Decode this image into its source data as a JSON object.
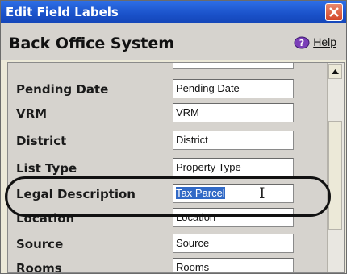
{
  "window": {
    "title": "Edit Field Labels"
  },
  "header": {
    "app_title": "Back Office System",
    "help_label": "Help"
  },
  "rows": [
    {
      "label": "Pending Date",
      "value": "Pending Date",
      "selected": false
    },
    {
      "label": "VRM",
      "value": "VRM",
      "selected": false
    },
    {
      "label": "District",
      "value": "District",
      "selected": false
    },
    {
      "label": "List Type",
      "value": "Property Type",
      "selected": false
    },
    {
      "label": "Legal Description",
      "value": "Tax Parcel",
      "selected": true
    },
    {
      "label": "Location",
      "value": "Location",
      "selected": false
    },
    {
      "label": "Source",
      "value": "Source",
      "selected": false
    },
    {
      "label": "Rooms",
      "value": "Rooms",
      "selected": false
    }
  ],
  "colors": {
    "titlebar": "#1a51c9",
    "selection": "#3169c6",
    "panel": "#d6d3ce"
  },
  "icons": {
    "close": "close-icon",
    "help": "help-icon",
    "scroll_up": "arrow-up-icon",
    "cursor": "i-beam-cursor-icon"
  }
}
